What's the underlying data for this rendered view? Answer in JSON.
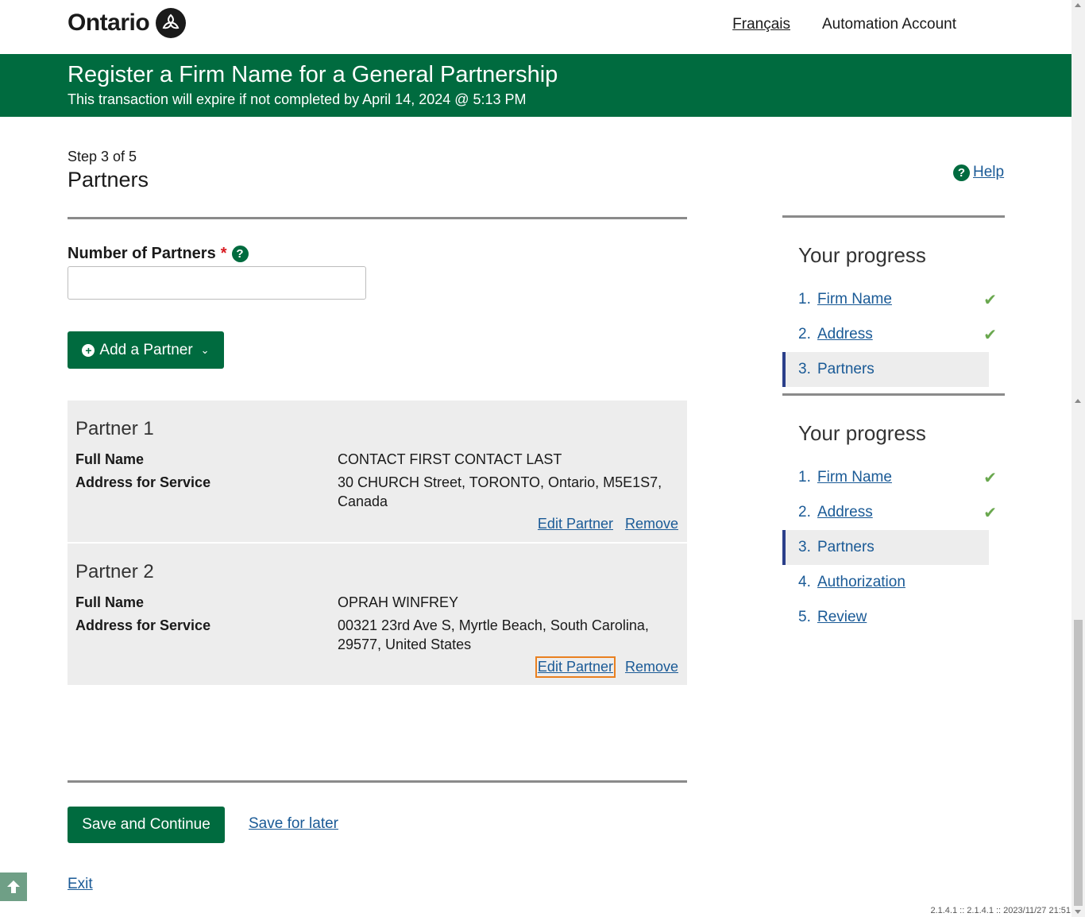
{
  "header": {
    "brand": "Ontario",
    "lang_link": "Français",
    "account": "Automation Account"
  },
  "banner": {
    "title": "Register a Firm Name for a General Partnership",
    "expiry": "This transaction will expire if not completed by April 14, 2024 @ 5:13 PM"
  },
  "page": {
    "step": "Step 3 of 5",
    "title": "Partners",
    "help": "Help"
  },
  "form": {
    "num_partners_label": "Number of Partners",
    "required_mark": "*",
    "num_partners_value": "",
    "add_partner": "Add a Partner"
  },
  "partners": [
    {
      "heading": "Partner 1",
      "name_label": "Full Name",
      "name": "CONTACT FIRST CONTACT LAST",
      "address_label": "Address for Service",
      "address": "30 CHURCH Street, TORONTO, Ontario, M5E1S7, Canada",
      "edit": "Edit Partner",
      "remove": "Remove"
    },
    {
      "heading": "Partner 2",
      "name_label": "Full Name",
      "name": "OPRAH WINFREY",
      "address_label": "Address for Service",
      "address": "00321 23rd Ave S, Myrtle Beach, South Carolina, 29577, United States",
      "edit": "Edit Partner",
      "remove": "Remove"
    }
  ],
  "actions": {
    "save_continue": "Save and Continue",
    "save_later": "Save for later",
    "exit": "Exit"
  },
  "progress_a": {
    "title": "Your progress",
    "items": [
      {
        "num": "1.",
        "label": "Firm Name",
        "done": true
      },
      {
        "num": "2.",
        "label": "Address",
        "done": true
      },
      {
        "num": "3.",
        "label": "Partners",
        "current": true
      }
    ]
  },
  "progress_b": {
    "title": "Your progress",
    "items": [
      {
        "num": "1.",
        "label": "Firm Name",
        "done": true
      },
      {
        "num": "2.",
        "label": "Address",
        "done": true
      },
      {
        "num": "3.",
        "label": "Partners",
        "current": true
      },
      {
        "num": "4.",
        "label": "Authorization"
      },
      {
        "num": "5.",
        "label": "Review"
      }
    ]
  },
  "footer": {
    "version": "2.1.4.1 :: 2.1.4.1 :: 2023/11/27 21:51"
  },
  "colors": {
    "brand_green": "#006b3f",
    "link_blue": "#1a5a96",
    "check_green": "#6aa84f",
    "focus_orange": "#e98020"
  }
}
